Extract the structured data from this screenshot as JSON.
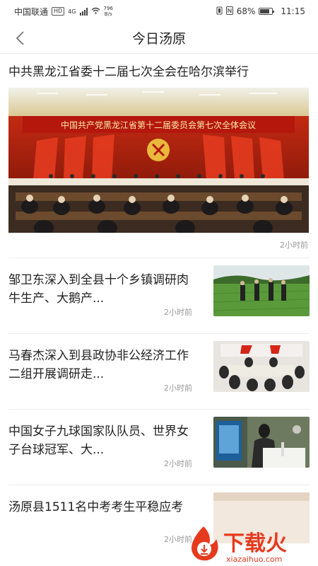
{
  "status_bar": {
    "carrier": "中国联通",
    "hd": "HD",
    "net": "4G",
    "speed_value": "796",
    "speed_unit": "B/s",
    "battery": "68%",
    "time": "11:15"
  },
  "nav": {
    "title": "今日汤原"
  },
  "headline": {
    "title": "中共黑龙江省委十二届七次全会在哈尔滨举行",
    "banner_text": "中国共产党黑龙江省第十二届委员会第七次全体会议",
    "time": "2小时前"
  },
  "news": [
    {
      "title": "邹卫东深入到全县十个乡镇调研肉牛生产、大鹅产...",
      "time": "2小时前"
    },
    {
      "title": "马春杰深入到县政协非公经济工作二组开展调研走...",
      "time": "2小时前"
    },
    {
      "title": "中国女子九球国家队队员、世界女子台球冠军、大...",
      "time": "2小时前"
    },
    {
      "title": "汤原县1511名中考考生平稳应考",
      "time": "2小时前"
    }
  ],
  "watermark": {
    "brand": "下载火",
    "domain": "xiazaihuo.com"
  },
  "colors": {
    "accent_red": "#d42517",
    "text_primary": "#222222",
    "text_secondary": "#999999",
    "divider": "#eeeeee"
  }
}
